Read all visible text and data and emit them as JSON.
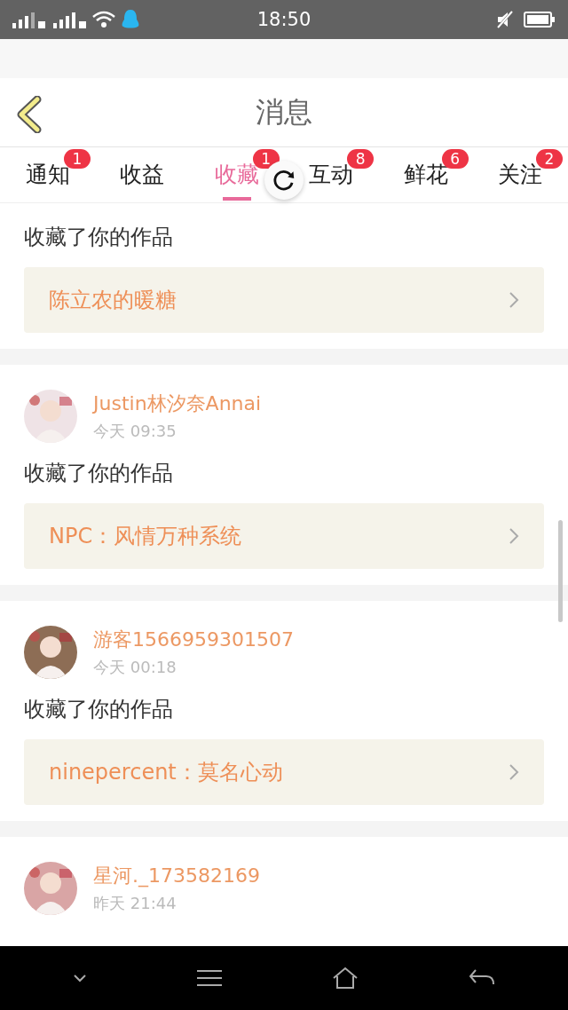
{
  "status_bar": {
    "time": "18:50"
  },
  "header": {
    "title": "消息"
  },
  "tabs": [
    {
      "label": "通知",
      "badge": "1",
      "selected": false
    },
    {
      "label": "收益",
      "selected": false
    },
    {
      "label": "收藏",
      "badge": "1",
      "selected": true
    },
    {
      "label": "互动",
      "badge": "8",
      "selected": false
    },
    {
      "label": "鲜花",
      "badge": "6",
      "selected": false
    },
    {
      "label": "关注",
      "badge": "2",
      "selected": false
    }
  ],
  "messages": [
    {
      "action": "收藏了你的作品",
      "work": "陈立农的暖糖"
    },
    {
      "user": "Justin林汐奈Annai",
      "time": "今天 09:35",
      "action": "收藏了你的作品",
      "work": "NPC：风情万种系统"
    },
    {
      "user": "游客1566959301507",
      "time": "今天 00:18",
      "action": "收藏了你的作品",
      "work": "ninepercent：莫名心动"
    },
    {
      "user": "星河._173582169",
      "time": "昨天 21:44"
    }
  ]
}
